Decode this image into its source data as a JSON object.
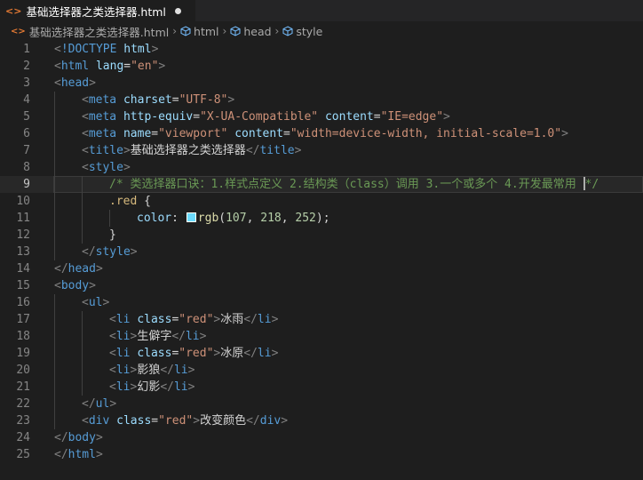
{
  "tab": {
    "icon": "<>",
    "filename": "基础选择器之类选择器.html",
    "unsaved": true
  },
  "breadcrumb": {
    "icon": "<>",
    "file": "基础选择器之类选择器.html",
    "items": [
      "html",
      "head",
      "style"
    ]
  },
  "editor": {
    "active_line": 9,
    "swatch_color": "#6bdafc",
    "lines": [
      {
        "num": "1",
        "indent": 0,
        "tokens": [
          [
            "g",
            "<"
          ],
          [
            "t",
            "!DOCTYPE"
          ],
          [
            "w",
            " "
          ],
          [
            "a",
            "html"
          ],
          [
            "g",
            ">"
          ]
        ]
      },
      {
        "num": "2",
        "indent": 0,
        "tokens": [
          [
            "g",
            "<"
          ],
          [
            "t",
            "html"
          ],
          [
            "w",
            " "
          ],
          [
            "a",
            "lang"
          ],
          [
            "w",
            "="
          ],
          [
            "s",
            "\"en\""
          ],
          [
            "g",
            ">"
          ]
        ]
      },
      {
        "num": "3",
        "indent": 0,
        "tokens": [
          [
            "g",
            "<"
          ],
          [
            "t",
            "head"
          ],
          [
            "g",
            ">"
          ]
        ]
      },
      {
        "num": "4",
        "indent": 1,
        "tokens": [
          [
            "g",
            "<"
          ],
          [
            "t",
            "meta"
          ],
          [
            "w",
            " "
          ],
          [
            "a",
            "charset"
          ],
          [
            "w",
            "="
          ],
          [
            "s",
            "\"UTF-8\""
          ],
          [
            "g",
            ">"
          ]
        ]
      },
      {
        "num": "5",
        "indent": 1,
        "tokens": [
          [
            "g",
            "<"
          ],
          [
            "t",
            "meta"
          ],
          [
            "w",
            " "
          ],
          [
            "a",
            "http-equiv"
          ],
          [
            "w",
            "="
          ],
          [
            "s",
            "\"X-UA-Compatible\""
          ],
          [
            "w",
            " "
          ],
          [
            "a",
            "content"
          ],
          [
            "w",
            "="
          ],
          [
            "s",
            "\"IE=edge\""
          ],
          [
            "g",
            ">"
          ]
        ]
      },
      {
        "num": "6",
        "indent": 1,
        "tokens": [
          [
            "g",
            "<"
          ],
          [
            "t",
            "meta"
          ],
          [
            "w",
            " "
          ],
          [
            "a",
            "name"
          ],
          [
            "w",
            "="
          ],
          [
            "s",
            "\"viewport\""
          ],
          [
            "w",
            " "
          ],
          [
            "a",
            "content"
          ],
          [
            "w",
            "="
          ],
          [
            "s",
            "\"width=device-width, initial-scale=1.0\""
          ],
          [
            "g",
            ">"
          ]
        ]
      },
      {
        "num": "7",
        "indent": 1,
        "tokens": [
          [
            "g",
            "<"
          ],
          [
            "t",
            "title"
          ],
          [
            "g",
            ">"
          ],
          [
            "w",
            "基础选择器之类选择器"
          ],
          [
            "g",
            "</"
          ],
          [
            "t",
            "title"
          ],
          [
            "g",
            ">"
          ]
        ]
      },
      {
        "num": "8",
        "indent": 1,
        "tokens": [
          [
            "g",
            "<"
          ],
          [
            "t",
            "style"
          ],
          [
            "g",
            ">"
          ]
        ]
      },
      {
        "num": "9",
        "indent": 2,
        "tokens": [
          [
            "c",
            "/* 类选择器口诀：1.样式点定义 2.结构类（class）调用 3.一个或多个 4.开发最常用 "
          ],
          [
            "cursor",
            ""
          ],
          [
            "c",
            "*/"
          ]
        ]
      },
      {
        "num": "10",
        "indent": 2,
        "tokens": [
          [
            "sel",
            ".red"
          ],
          [
            "w",
            " {"
          ]
        ]
      },
      {
        "num": "11",
        "indent": 3,
        "tokens": [
          [
            "a",
            "color"
          ],
          [
            "w",
            ": "
          ],
          [
            "swatch",
            ""
          ],
          [
            "fn",
            "rgb"
          ],
          [
            "w",
            "("
          ],
          [
            "n",
            "107"
          ],
          [
            "w",
            ", "
          ],
          [
            "n",
            "218"
          ],
          [
            "w",
            ", "
          ],
          [
            "n",
            "252"
          ],
          [
            "w",
            ");"
          ]
        ]
      },
      {
        "num": "12",
        "indent": 2,
        "tokens": [
          [
            "w",
            "}"
          ]
        ]
      },
      {
        "num": "13",
        "indent": 1,
        "tokens": [
          [
            "g",
            "</"
          ],
          [
            "t",
            "style"
          ],
          [
            "g",
            ">"
          ]
        ]
      },
      {
        "num": "14",
        "indent": 0,
        "tokens": [
          [
            "g",
            "</"
          ],
          [
            "t",
            "head"
          ],
          [
            "g",
            ">"
          ]
        ]
      },
      {
        "num": "15",
        "indent": 0,
        "tokens": [
          [
            "g",
            "<"
          ],
          [
            "t",
            "body"
          ],
          [
            "g",
            ">"
          ]
        ]
      },
      {
        "num": "16",
        "indent": 1,
        "tokens": [
          [
            "g",
            "<"
          ],
          [
            "t",
            "ul"
          ],
          [
            "g",
            ">"
          ]
        ]
      },
      {
        "num": "17",
        "indent": 2,
        "tokens": [
          [
            "g",
            "<"
          ],
          [
            "t",
            "li"
          ],
          [
            "w",
            " "
          ],
          [
            "a",
            "class"
          ],
          [
            "w",
            "="
          ],
          [
            "s",
            "\"red\""
          ],
          [
            "g",
            ">"
          ],
          [
            "w",
            "冰雨"
          ],
          [
            "g",
            "</"
          ],
          [
            "t",
            "li"
          ],
          [
            "g",
            ">"
          ]
        ]
      },
      {
        "num": "18",
        "indent": 2,
        "tokens": [
          [
            "g",
            "<"
          ],
          [
            "t",
            "li"
          ],
          [
            "g",
            ">"
          ],
          [
            "w",
            "生僻字"
          ],
          [
            "g",
            "</"
          ],
          [
            "t",
            "li"
          ],
          [
            "g",
            ">"
          ]
        ]
      },
      {
        "num": "19",
        "indent": 2,
        "tokens": [
          [
            "g",
            "<"
          ],
          [
            "t",
            "li"
          ],
          [
            "w",
            " "
          ],
          [
            "a",
            "class"
          ],
          [
            "w",
            "="
          ],
          [
            "s",
            "\"red\""
          ],
          [
            "g",
            ">"
          ],
          [
            "w",
            "冰原"
          ],
          [
            "g",
            "</"
          ],
          [
            "t",
            "li"
          ],
          [
            "g",
            ">"
          ]
        ]
      },
      {
        "num": "20",
        "indent": 2,
        "tokens": [
          [
            "g",
            "<"
          ],
          [
            "t",
            "li"
          ],
          [
            "g",
            ">"
          ],
          [
            "w",
            "影狼"
          ],
          [
            "g",
            "</"
          ],
          [
            "t",
            "li"
          ],
          [
            "g",
            ">"
          ]
        ]
      },
      {
        "num": "21",
        "indent": 2,
        "tokens": [
          [
            "g",
            "<"
          ],
          [
            "t",
            "li"
          ],
          [
            "g",
            ">"
          ],
          [
            "w",
            "幻影"
          ],
          [
            "g",
            "</"
          ],
          [
            "t",
            "li"
          ],
          [
            "g",
            ">"
          ]
        ]
      },
      {
        "num": "22",
        "indent": 1,
        "tokens": [
          [
            "g",
            "</"
          ],
          [
            "t",
            "ul"
          ],
          [
            "g",
            ">"
          ]
        ]
      },
      {
        "num": "23",
        "indent": 1,
        "tokens": [
          [
            "g",
            "<"
          ],
          [
            "t",
            "div"
          ],
          [
            "w",
            " "
          ],
          [
            "a",
            "class"
          ],
          [
            "w",
            "="
          ],
          [
            "s",
            "\"red\""
          ],
          [
            "g",
            ">"
          ],
          [
            "w",
            "改变颜色"
          ],
          [
            "g",
            "</"
          ],
          [
            "t",
            "div"
          ],
          [
            "g",
            ">"
          ]
        ]
      },
      {
        "num": "24",
        "indent": 0,
        "tokens": [
          [
            "g",
            "</"
          ],
          [
            "t",
            "body"
          ],
          [
            "g",
            ">"
          ]
        ]
      },
      {
        "num": "25",
        "indent": 0,
        "tokens": [
          [
            "g",
            "</"
          ],
          [
            "t",
            "html"
          ],
          [
            "g",
            ">"
          ]
        ]
      }
    ]
  }
}
